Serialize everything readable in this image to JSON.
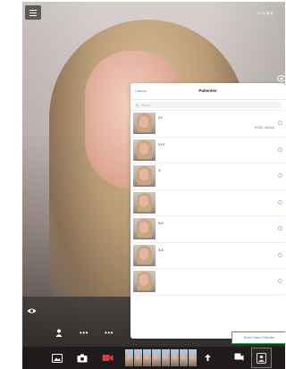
{
  "status_bar": {
    "text": "12:00  ◉  ▮"
  },
  "patients_popover": {
    "title": "Patienten",
    "cancel_label": "Cancel",
    "search_placeholder": "Suche",
    "reset_button_label": "Reset Patient Selection",
    "items": [
      {
        "name": "XY",
        "subtitle": "HOSU: 48156A"
      },
      {
        "name": "XYZ",
        "subtitle": ""
      },
      {
        "name": "G",
        "subtitle": ""
      },
      {
        "name": "",
        "subtitle": ""
      },
      {
        "name": "A A",
        "subtitle": ""
      },
      {
        "name": "A A",
        "subtitle": ""
      },
      {
        "name": "",
        "subtitle": ""
      }
    ]
  },
  "controls": {
    "dots_a": "•••",
    "dots_b": "•••"
  },
  "toolbar": {
    "filmstrip_frames": 8
  },
  "colors": {
    "accent_blue": "#3a86e8",
    "highlight_green": "#2fa84f"
  },
  "icons": [
    "menu-icon",
    "eye-icon",
    "camera-switch-icon",
    "gallery-icon",
    "camera-icon",
    "video-icon",
    "share-icon",
    "lens-icon",
    "patient-icon",
    "info-icon"
  ]
}
